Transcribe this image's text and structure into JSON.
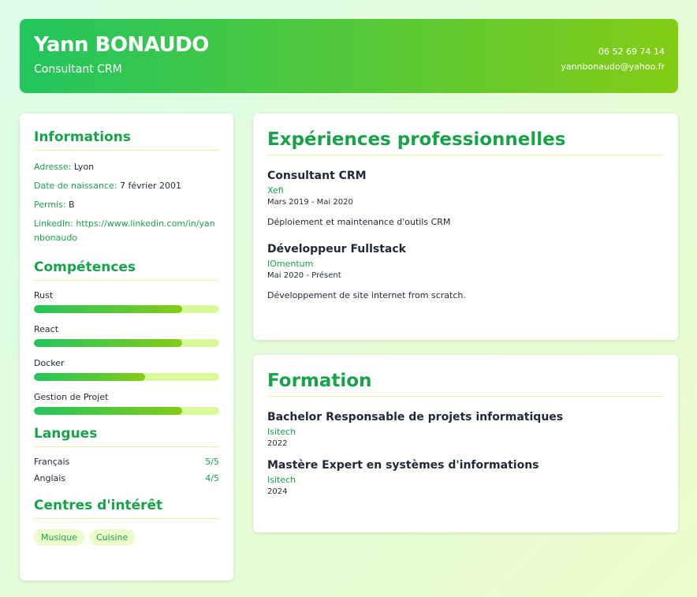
{
  "header": {
    "name": "Yann BONAUDO",
    "role": "Consultant CRM",
    "phone": "06 52 69 74 14",
    "email": "yannbonaudo@yahoo.fr"
  },
  "info": {
    "title": "Informations",
    "items": [
      {
        "key": "Adresse:",
        "value": "Lyon"
      },
      {
        "key": "Date de naissance:",
        "value": "7 février 2001"
      },
      {
        "key": "Permis:",
        "value": "B"
      },
      {
        "key": "LinkedIn:",
        "value": "https://www.linkedin.com/in/yannbonaudo"
      }
    ]
  },
  "skills": {
    "title": "Compétences",
    "items": [
      {
        "name": "Rust",
        "level": 80
      },
      {
        "name": "React",
        "level": 80
      },
      {
        "name": "Docker",
        "level": 60
      },
      {
        "name": "Gestion de Projet",
        "level": 80
      }
    ]
  },
  "languages": {
    "title": "Langues",
    "items": [
      {
        "name": "Français",
        "level": "5/5"
      },
      {
        "name": "Anglais",
        "level": "4/5"
      }
    ]
  },
  "interests": {
    "title": "Centres d'intérêt",
    "items": [
      "Musique",
      "Cuisine"
    ]
  },
  "experience": {
    "title": "Expériences professionnelles",
    "items": [
      {
        "title": "Consultant CRM",
        "company": "Xefi",
        "dates": "Mars 2019 - Mai 2020",
        "description": "Déploiement et maintenance d'outils CRM"
      },
      {
        "title": "Développeur Fullstack",
        "company": "IOmentum",
        "dates": "Mai 2020 - Présent",
        "description": "Développement de site internet from scratch."
      }
    ]
  },
  "education": {
    "title": "Formation",
    "items": [
      {
        "title": "Bachelor Responsable de projets informatiques",
        "school": "Isitech",
        "year": "2022"
      },
      {
        "title": "Mastère Expert en systèmes d'informations",
        "school": "Isitech",
        "year": "2024"
      }
    ]
  },
  "colors": {
    "primary": "#22c55e",
    "secondary": "#84cc16",
    "light": "#d9f99d"
  }
}
